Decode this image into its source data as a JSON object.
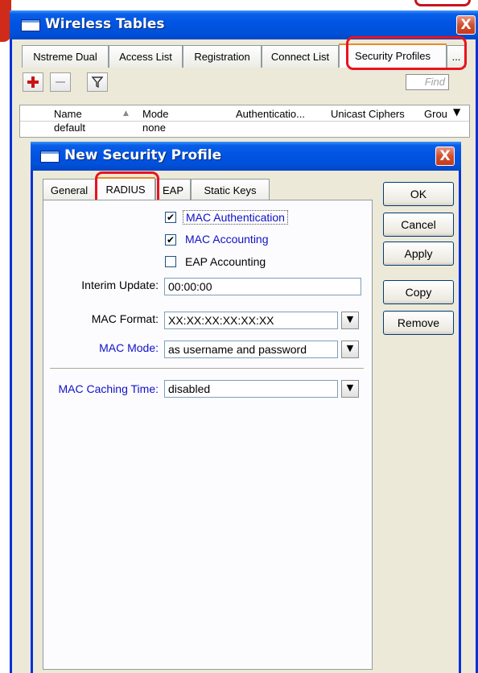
{
  "outer_window": {
    "title": "Wireless Tables",
    "close_label": "X",
    "tabs": [
      "Nstreme Dual",
      "Access List",
      "Registration",
      "Connect List",
      "Security Profiles",
      "..."
    ],
    "active_tab": "Security Profiles",
    "toolbar": {
      "find_placeholder": "Find"
    },
    "table": {
      "columns": [
        "Name",
        "Mode",
        "Authenticatio...",
        "Unicast Ciphers",
        "Grou"
      ],
      "rows": [
        {
          "name": "default",
          "mode": "none"
        }
      ]
    }
  },
  "dialog": {
    "title": "New Security Profile",
    "close_label": "X",
    "tabs": [
      "General",
      "RADIUS",
      "EAP",
      "Static Keys"
    ],
    "active_tab": "RADIUS",
    "checkboxes": [
      {
        "label": "MAC Authentication",
        "checked": true
      },
      {
        "label": "MAC Accounting",
        "checked": true
      },
      {
        "label": "EAP Accounting",
        "checked": false
      }
    ],
    "fields": {
      "interim_update": {
        "label": "Interim Update:",
        "value": "00:00:00"
      },
      "mac_format": {
        "label": "MAC Format:",
        "value": "XX:XX:XX:XX:XX:XX"
      },
      "mac_mode": {
        "label": "MAC Mode:",
        "value": "as username and password"
      },
      "mac_caching_time": {
        "label": "MAC Caching Time:",
        "value": "disabled"
      }
    },
    "buttons": [
      "OK",
      "Cancel",
      "Apply",
      "Copy",
      "Remove"
    ]
  },
  "colors": {
    "title_bar": "#0054e3",
    "highlight": "#e8141e",
    "blue_label": "#1010c8"
  }
}
